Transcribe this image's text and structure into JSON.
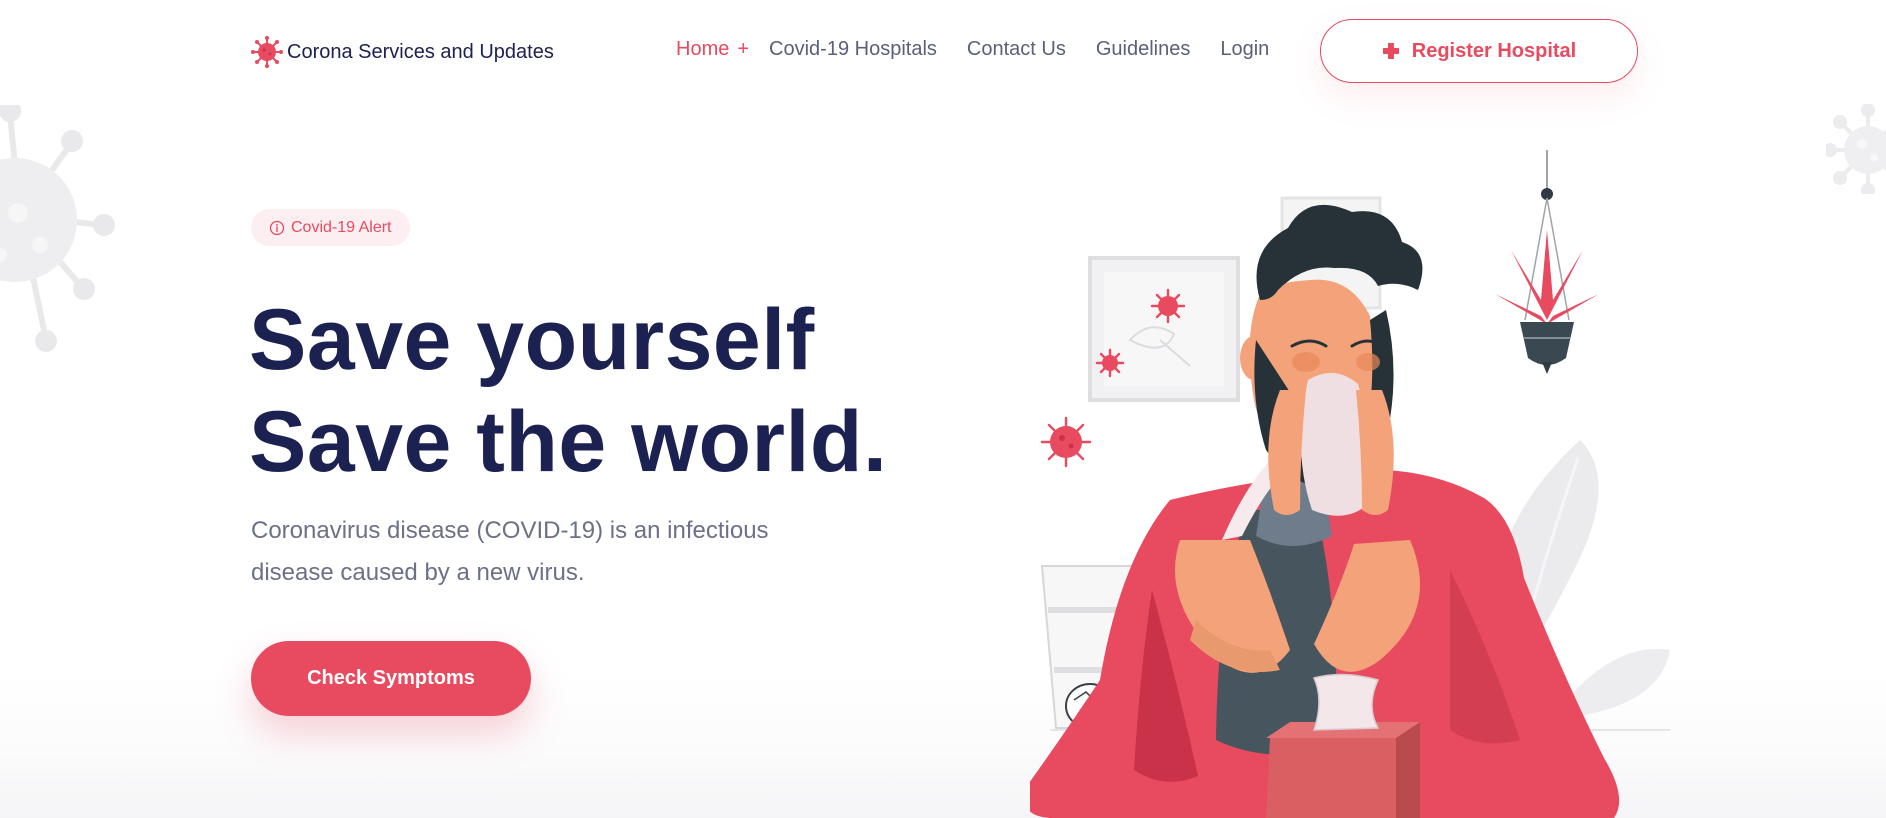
{
  "brand": {
    "name": "Corona Services and Updates",
    "icon": "virus-icon"
  },
  "nav": {
    "items": [
      {
        "label": "Home",
        "suffix": "+",
        "active": true
      },
      {
        "label": "Covid-19 Hospitals",
        "active": false
      },
      {
        "label": "Contact Us",
        "active": false
      },
      {
        "label": "Guidelines",
        "active": false
      },
      {
        "label": "Login",
        "active": false
      }
    ],
    "register": {
      "label": "Register Hospital",
      "icon": "medical-cross-icon"
    }
  },
  "hero": {
    "badge": {
      "label": "Covid-19 Alert",
      "icon": "info-circle-icon"
    },
    "title_line1": "Save yourself",
    "title_line2": "Save the world.",
    "description_line1": "Coronavirus disease (COVID-19) is an infectious",
    "description_line2": "disease caused by a new virus.",
    "cta": {
      "label": "Check Symptoms"
    }
  },
  "colors": {
    "accent": "#e84a5f",
    "heading": "#1b2150",
    "body_text": "#6c7088",
    "badge_bg": "#fdeff1"
  }
}
